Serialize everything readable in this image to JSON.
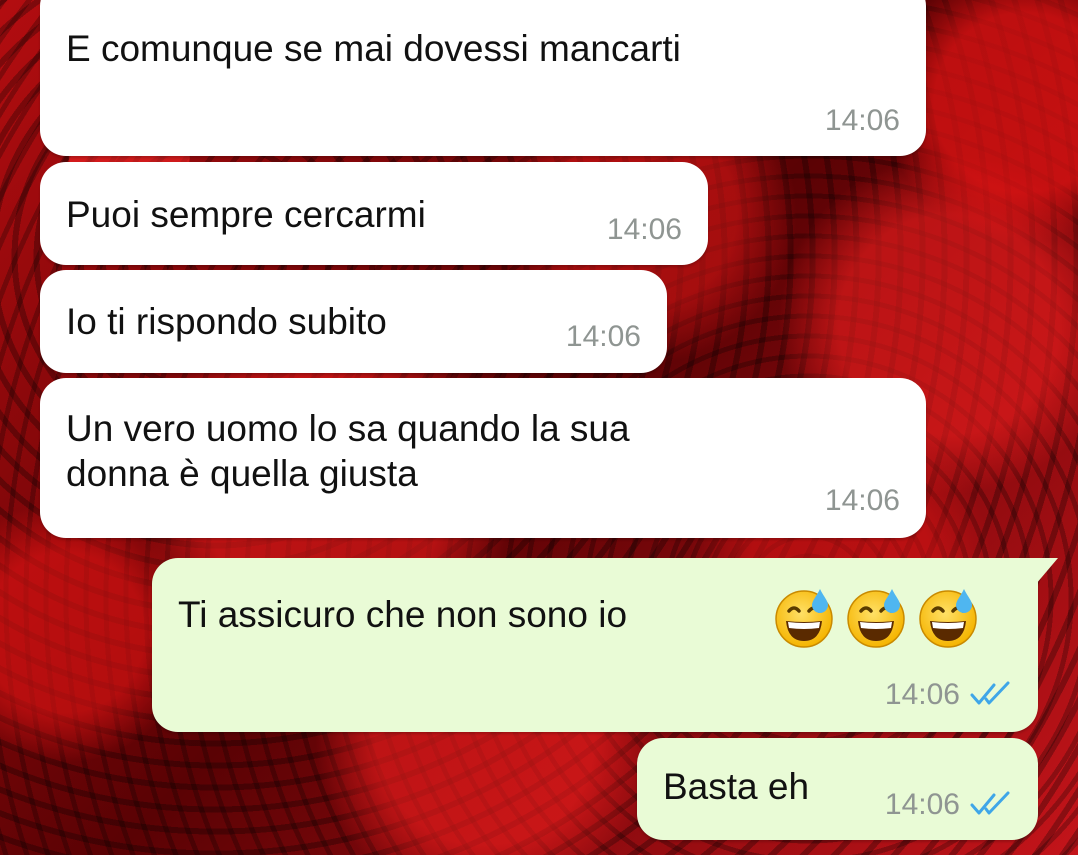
{
  "chat": {
    "wallpaper": "red-roses-wallpaper",
    "colors": {
      "incoming_bubble": "#ffffff",
      "outgoing_bubble": "#e9fbd6",
      "timestamp": "#8f9592",
      "read_ticks": "#3fa6e8"
    },
    "messages": [
      {
        "direction": "incoming",
        "text": "E comunque se mai dovessi mancarti",
        "time": "14:06"
      },
      {
        "direction": "incoming",
        "text": "Puoi sempre cercarmi",
        "time": "14:06"
      },
      {
        "direction": "incoming",
        "text": "Io ti rispondo subito",
        "time": "14:06"
      },
      {
        "direction": "incoming",
        "text": "Un vero uomo lo sa quando la sua\ndonna è quella giusta",
        "time": "14:06"
      },
      {
        "direction": "outgoing",
        "text": "Ti assicuro che non sono io",
        "emojis": [
          "grinning-face-with-sweat-emoji",
          "grinning-face-with-sweat-emoji",
          "grinning-face-with-sweat-emoji"
        ],
        "time": "14:06",
        "status": "read"
      },
      {
        "direction": "outgoing",
        "text": "Basta eh",
        "time": "14:06",
        "status": "read"
      }
    ]
  }
}
